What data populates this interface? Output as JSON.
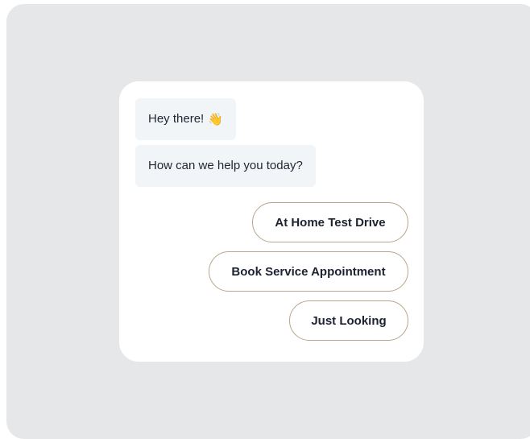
{
  "messages": [
    {
      "text": "Hey there!",
      "icon": "waving-hand-icon"
    },
    {
      "text": "How can we help you today?"
    }
  ],
  "quick_replies": [
    {
      "label": "At Home Test Drive"
    },
    {
      "label": "Book Service Appointment"
    },
    {
      "label": "Just Looking"
    }
  ],
  "colors": {
    "backdrop": "#e6e7e9",
    "card": "#ffffff",
    "bubble": "#f2f5f7",
    "button_border": "#b9a58b",
    "text": "#1d2230"
  }
}
